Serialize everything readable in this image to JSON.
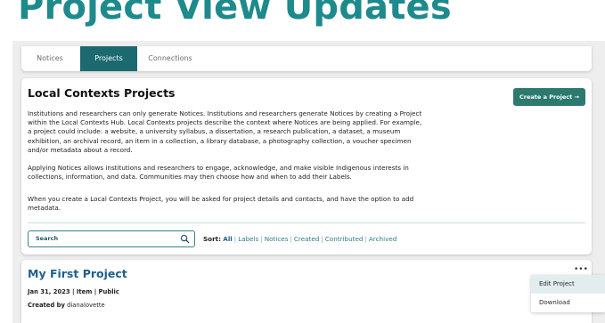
{
  "hero_title": "Project View Updates",
  "tabs": [
    {
      "label": "Notices"
    },
    {
      "label": "Projects",
      "active": true
    },
    {
      "label": "Connections"
    }
  ],
  "main": {
    "title": "Local Contexts Projects",
    "create_button": "Create a Project →",
    "paragraphs": [
      "Institutions and researchers can only generate Notices. Institutions and researchers generate Notices by creating a Project within the Local Contexts Hub. Local Contexts projects describe the context where Notices are being applied. For example, a project could include: a website, a university syllabus, a dissertation, a research publication, a dataset, a museum exhibition, an archival record, an item in a collection, a library database, a photography collection, a voucher specimen and/or metadata about a record.",
      "Applying Notices allows institutions and researchers to engage, acknowledge, and make visible Indigenous interests in collections, information, and data. Communities may then choose how and when to add their Labels.",
      "When you create a Local Contexts Project, you will be asked for project details and contacts, and have the option to add metadata."
    ],
    "search_placeholder": "Search",
    "sort_label": "Sort:",
    "sort_options": [
      "All",
      "Labels",
      "Notices",
      "Created",
      "Contributed",
      "Archived"
    ]
  },
  "project": {
    "title": "My First Project",
    "meta": "Jan 31, 2023 | Item | Public",
    "created_by_label": "Created by",
    "created_by": "dianalovette",
    "menu_glyph": "•••",
    "menu_items": [
      "Edit Project",
      "Download"
    ]
  },
  "colors": {
    "accent": "#1e8a8c",
    "tab_active": "#1d6970",
    "button": "#2b7a6d",
    "link": "#1e5f8c"
  }
}
